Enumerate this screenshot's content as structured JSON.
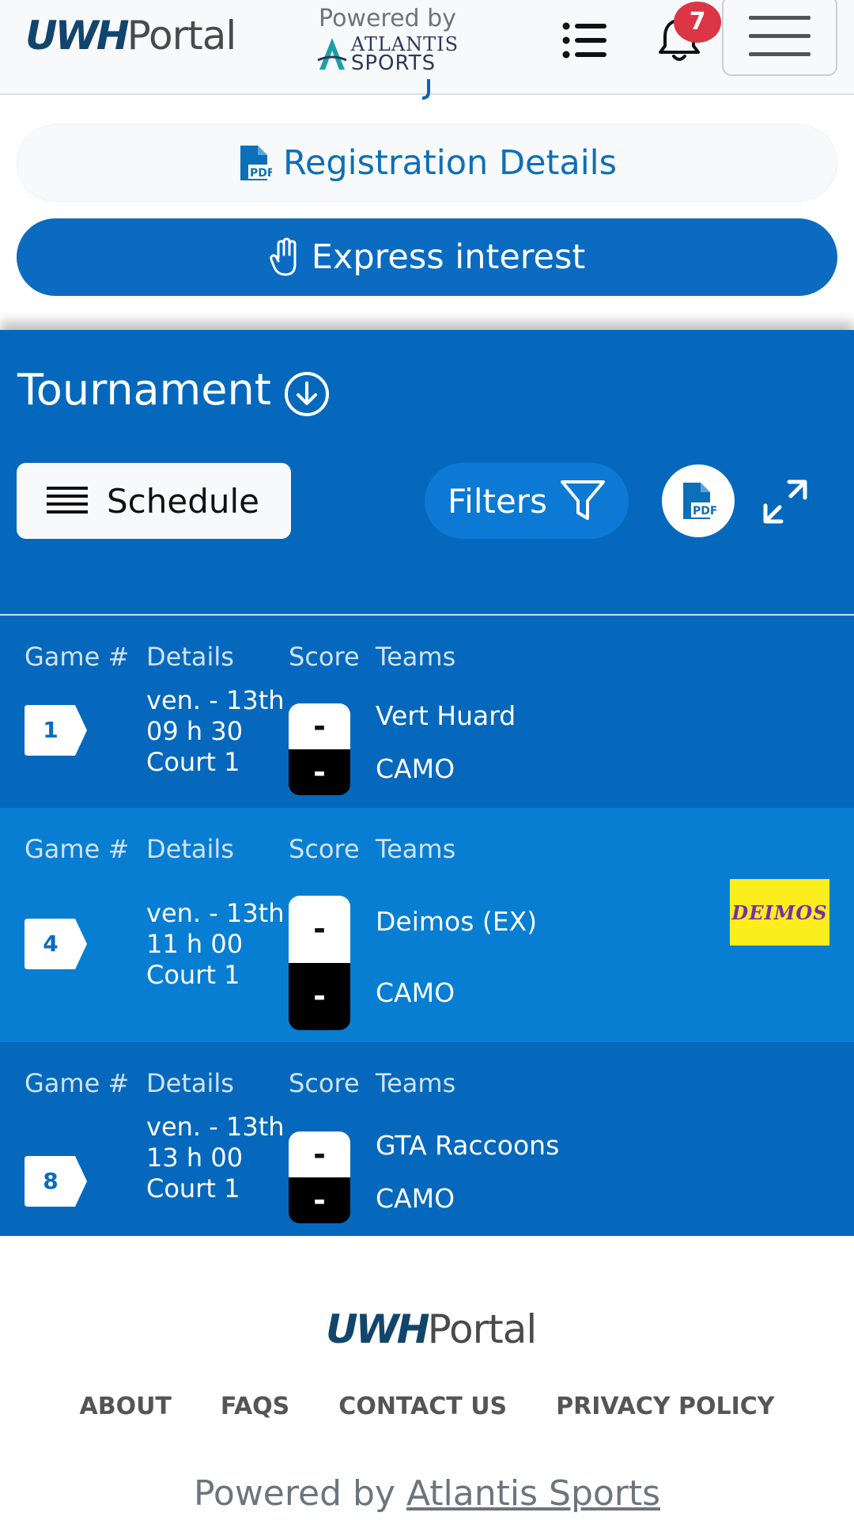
{
  "header": {
    "logo_uwh": "UWH",
    "logo_portal": "Portal",
    "powered_by": "Powered by",
    "atlantis_line1": "ATLANTIS",
    "atlantis_line2": "SPORTS",
    "notification_count": "7"
  },
  "buttons": {
    "registration_details": "Registration Details",
    "express_interest": "Express interest"
  },
  "tournament": {
    "title": "Tournament",
    "view_mode": "Schedule",
    "filters": "Filters",
    "pdf_label": "PDF",
    "column_headers": {
      "game": "Game #",
      "details": "Details",
      "score": "Score",
      "teams": "Teams"
    },
    "games": [
      {
        "number": "1",
        "day": "ven. - 13th",
        "time": "09 h 30",
        "court": "Court 1",
        "score_home": "-",
        "score_away": "-",
        "team_home": "Vert Huard",
        "team_away": "CAMO",
        "home_logo": ""
      },
      {
        "number": "4",
        "day": "ven. - 13th",
        "time": "11 h 00",
        "court": "Court 1",
        "score_home": "-",
        "score_away": "-",
        "team_home": "Deimos (EX)",
        "team_away": "CAMO",
        "home_logo": "DEIMOS"
      },
      {
        "number": "8",
        "day": "ven. - 13th",
        "time": "13 h 00",
        "court": "Court 1",
        "score_home": "-",
        "score_away": "-",
        "team_home": "GTA Raccoons",
        "team_away": "CAMO",
        "home_logo": ""
      }
    ]
  },
  "footer": {
    "logo_uwh": "UWH",
    "logo_portal": "Portal",
    "nav": [
      "ABOUT",
      "FAQS",
      "CONTACT US",
      "PRIVACY POLICY"
    ],
    "powered_prefix": "Powered by",
    "powered_link": "Atlantis Sports"
  },
  "colors": {
    "primary": "#0a6bc1",
    "section_bg": "#0568bd",
    "row_alt_bg": "#077ed2",
    "badge_red": "#dc3545",
    "deimos_yellow": "#fbee1f"
  }
}
